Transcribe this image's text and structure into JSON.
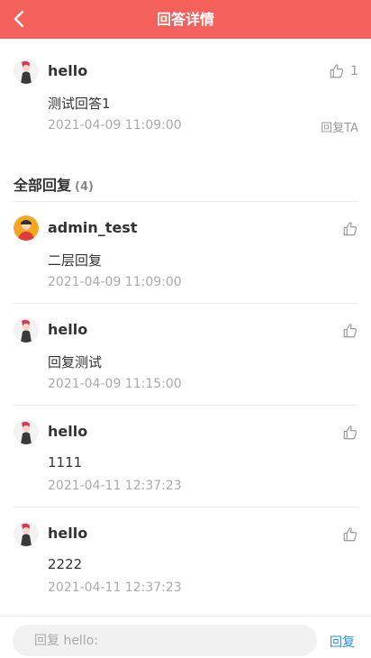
{
  "header": {
    "title": "回答详情"
  },
  "answer": {
    "author": "hello",
    "content": "测试回答1",
    "time": "2021-04-09 11:09:00",
    "likes": "1",
    "reply_label": "回复TA"
  },
  "replies_section": {
    "title": "全部回复",
    "count": "(4)"
  },
  "replies": [
    {
      "author": "admin_test",
      "content": "二层回复",
      "time": "2021-04-09 11:09:00"
    },
    {
      "author": "hello",
      "content": "回复测试",
      "time": "2021-04-09 11:15:00"
    },
    {
      "author": "hello",
      "content": "1111",
      "time": "2021-04-11 12:37:23"
    },
    {
      "author": "hello",
      "content": "2222",
      "time": "2021-04-11 12:37:23"
    }
  ],
  "composer": {
    "placeholder": "回复 hello:",
    "send_label": "回复"
  },
  "colors": {
    "header": "#f4605a",
    "link": "#2a8ee6"
  }
}
